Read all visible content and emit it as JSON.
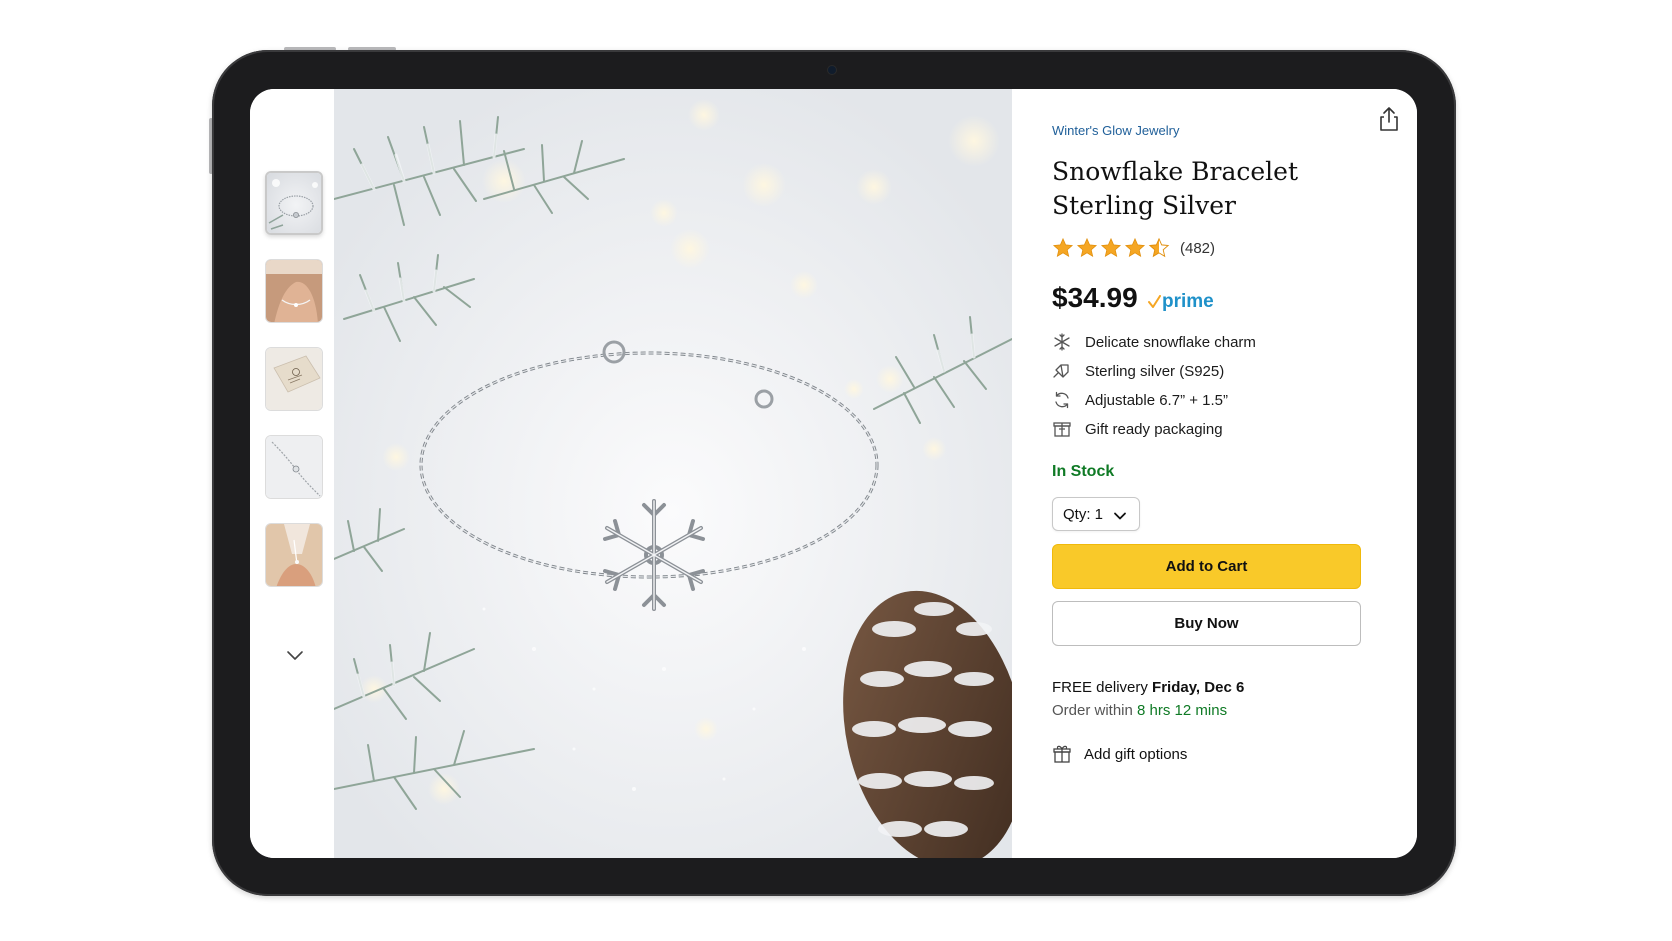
{
  "product": {
    "brand": "Winter's Glow Jewelry",
    "title_line1": "Snowflake Bracelet",
    "title_line2": "Sterling Silver",
    "rating": 4.5,
    "rating_count": "(482)",
    "price": "$34.99",
    "prime_label": "prime",
    "features": [
      {
        "icon": "snowflake-icon",
        "text": "Delicate snowflake charm"
      },
      {
        "icon": "diamond-icon",
        "text": "Sterling silver (S925)"
      },
      {
        "icon": "adjust-cycle-icon",
        "text": "Adjustable 6.7” + 1.5”"
      },
      {
        "icon": "gift-box-icon",
        "text": "Gift ready packaging"
      }
    ],
    "stock_status": "In Stock"
  },
  "purchase": {
    "qty_label": "Qty: 1",
    "add_to_cart": "Add to Cart",
    "buy_now": "Buy Now"
  },
  "delivery": {
    "prefix": "FREE delivery ",
    "date": "Friday, Dec 6",
    "order_prefix": "Order within ",
    "countdown": "8 hrs 12 mins",
    "gift_options": "Add gift options"
  },
  "gallery": {
    "thumbnails": [
      "bracelet-on-snow",
      "bracelet-on-wrist",
      "gift-box",
      "bracelet-close-up",
      "bracelet-worn-sweater"
    ],
    "selected_index": 0
  },
  "colors": {
    "brand_link": "#1f5f99",
    "star": "#f5a623",
    "prime": "#1f91c9",
    "in_stock": "#0f7a25",
    "cart_button": "#f9c929"
  }
}
